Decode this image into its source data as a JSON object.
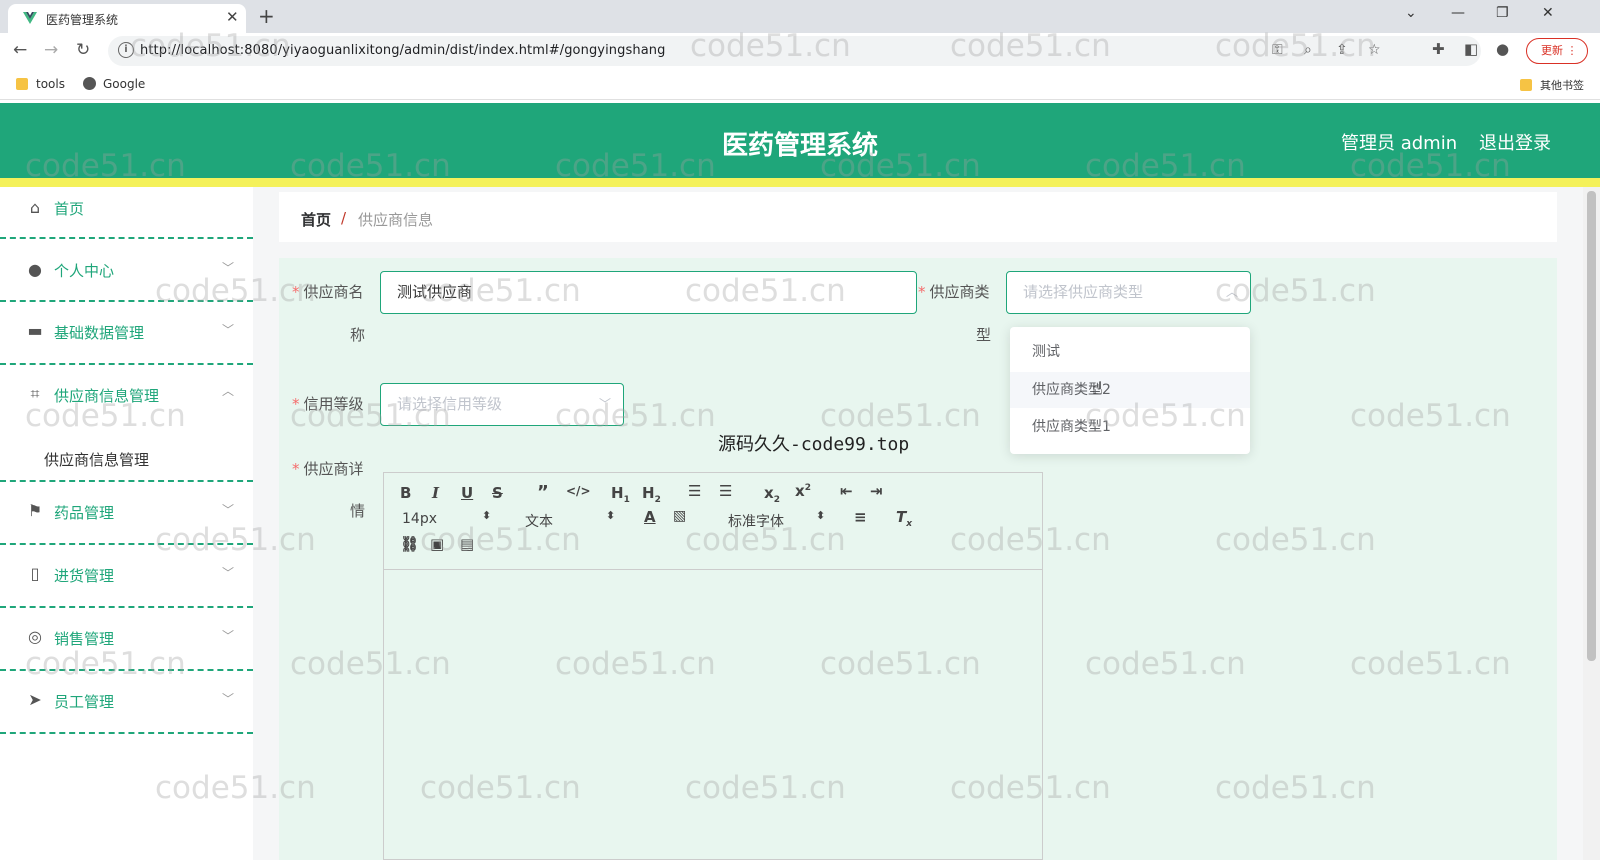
{
  "browser": {
    "tab_title": "医药管理系统",
    "url": "http://localhost:8080/yiyaoguanlixitong/admin/dist/index.html#/gongyingshang",
    "update_label": "更新",
    "bookmarks": [
      "tools",
      "Google"
    ],
    "other_bookmarks": "其他书签"
  },
  "header": {
    "title": "医药管理系统",
    "user": "管理员 admin",
    "logout": "退出登录",
    "colors": {
      "header": "#1fa67a",
      "accent_bar": "#f4f15a"
    }
  },
  "sidebar": {
    "items": [
      {
        "label": "首页",
        "icon": "home-icon",
        "expandable": false
      },
      {
        "label": "个人中心",
        "icon": "user-icon",
        "expandable": true
      },
      {
        "label": "基础数据管理",
        "icon": "monitor-icon",
        "expandable": true
      },
      {
        "label": "供应商信息管理",
        "icon": "crop-icon",
        "expandable": true,
        "expanded": true
      },
      {
        "label": "药品管理",
        "icon": "flag-icon",
        "expandable": true
      },
      {
        "label": "进货管理",
        "icon": "phone-icon",
        "expandable": true
      },
      {
        "label": "销售管理",
        "icon": "target-icon",
        "expandable": true
      },
      {
        "label": "员工管理",
        "icon": "send-icon",
        "expandable": true
      }
    ],
    "submenu": [
      "供应商信息管理"
    ]
  },
  "breadcrumb": {
    "home": "首页",
    "separator": "/",
    "current": "供应商信息"
  },
  "form": {
    "name_label_1": "供应商名",
    "name_label_2": "称",
    "name_value": "测试供应商",
    "type_label_1": "供应商类",
    "type_label_2": "型",
    "type_placeholder": "请选择供应商类型",
    "credit_label": "信用等级",
    "credit_placeholder": "请选择信用等级",
    "detail_label_1": "供应商详",
    "detail_label_2": "情",
    "type_options": [
      "测试",
      "供应商类型2",
      "供应商类型1"
    ]
  },
  "editor": {
    "font_size": "14px",
    "paragraph": "文本",
    "font_family": "标准字体"
  },
  "overlay_text": "源码久久-code99.top",
  "watermark": "code51.cn"
}
